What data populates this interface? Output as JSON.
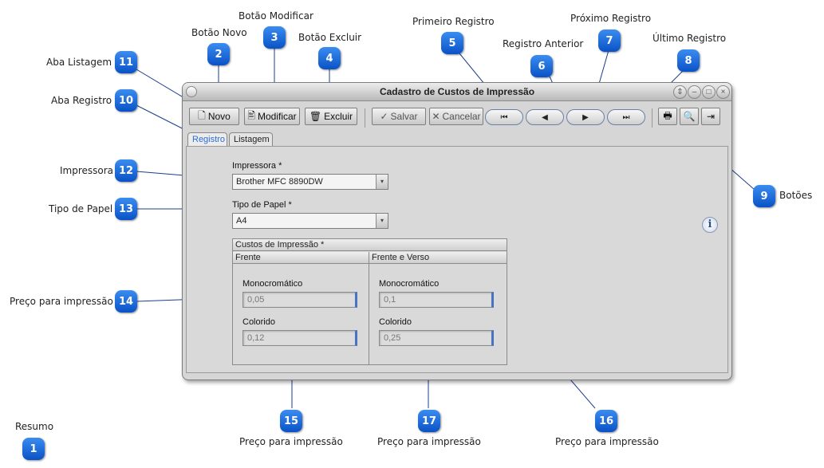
{
  "window": {
    "title": "Cadastro de Custos de Impressão"
  },
  "toolbar": {
    "novo": "Novo",
    "modificar": "Modificar",
    "excluir": "Excluir",
    "salvar": "Salvar",
    "cancelar": "Cancelar"
  },
  "tabs": [
    {
      "label": "Registro"
    },
    {
      "label": "Listagem"
    }
  ],
  "form": {
    "impressora_label": "Impressora *",
    "impressora_value": "Brother MFC 8890DW",
    "tipo_papel_label": "Tipo de Papel *",
    "tipo_papel_value": "A4",
    "group_title": "Custos de Impressão *",
    "col_frente": "Frente",
    "col_frente_verso": "Frente e Verso",
    "mono_label": "Monocromático",
    "color_label": "Colorido",
    "frente_mono": "0,05",
    "frente_color": "0,12",
    "fv_mono": "0,1",
    "fv_color": "0,25"
  },
  "callouts": {
    "c1": {
      "num": "1",
      "label": "Resumo"
    },
    "c2": {
      "num": "2",
      "label": "Botão Novo"
    },
    "c3": {
      "num": "3",
      "label": "Botão Modificar"
    },
    "c4": {
      "num": "4",
      "label": "Botão Excluir"
    },
    "c5": {
      "num": "5",
      "label": "Primeiro Registro"
    },
    "c6": {
      "num": "6",
      "label": "Registro Anterior"
    },
    "c7": {
      "num": "7",
      "label": "Próximo Registro"
    },
    "c8": {
      "num": "8",
      "label": "Último Registro"
    },
    "c9": {
      "num": "9",
      "label": "Botões"
    },
    "c10": {
      "num": "10",
      "label": "Aba Registro"
    },
    "c11": {
      "num": "11",
      "label": "Aba Listagem"
    },
    "c12": {
      "num": "12",
      "label": "Impressora"
    },
    "c13": {
      "num": "13",
      "label": "Tipo de Papel"
    },
    "c14": {
      "num": "14",
      "label": "Preço para impressão"
    },
    "c15": {
      "num": "15",
      "label": "Preço para impressão"
    },
    "c16": {
      "num": "16",
      "label": "Preço para impressão"
    },
    "c17": {
      "num": "17",
      "label": "Preço para impressão"
    }
  }
}
